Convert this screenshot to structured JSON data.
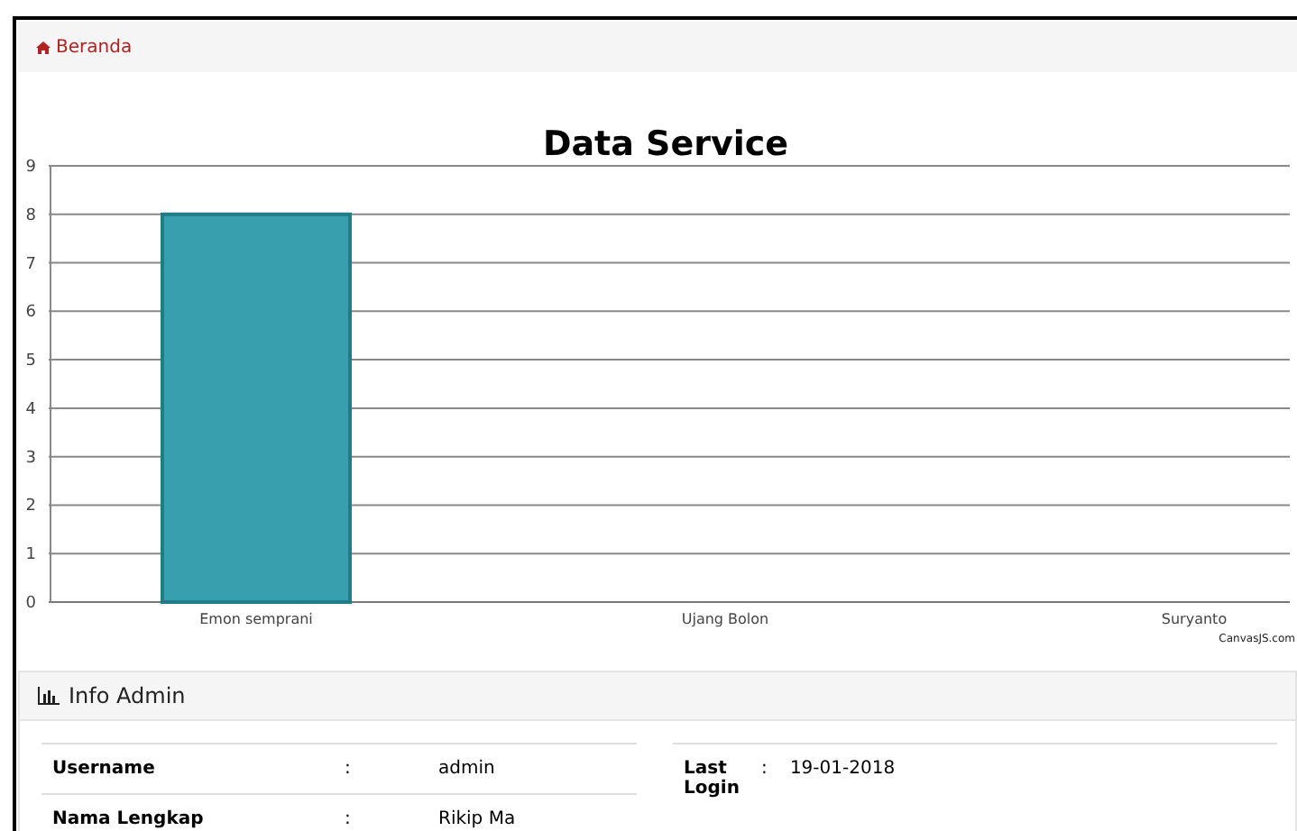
{
  "breadcrumb": {
    "label": "Beranda"
  },
  "chart": {
    "chart_data": {
      "type": "bar",
      "title": "Data Service",
      "categories": [
        "Emon semprani",
        "Ujang Bolon",
        "Suryanto"
      ],
      "series": [
        {
          "color": "#379fae",
          "values": [
            8,
            0,
            0
          ]
        }
      ],
      "grid": true,
      "ylim": [
        0,
        9
      ],
      "yticks": [
        0,
        1,
        2,
        3,
        4,
        5,
        6,
        7,
        8,
        9
      ]
    },
    "credit": "CanvasJS.com"
  },
  "info_panel": {
    "title": "Info Admin",
    "left_rows": [
      {
        "label": "Username",
        "separator": ":",
        "value": "admin"
      },
      {
        "label": "Nama Lengkap",
        "separator": ":",
        "value": "Rikip Ma"
      }
    ],
    "right_rows": [
      {
        "label": "Last Login",
        "separator": ":",
        "value": "19-01-2018"
      }
    ]
  }
}
